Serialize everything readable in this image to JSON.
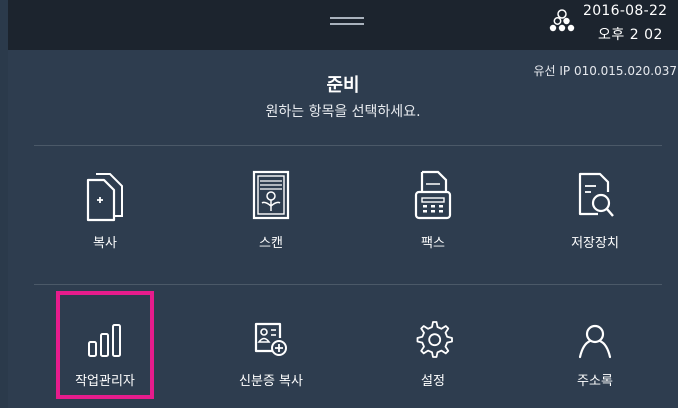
{
  "status": {
    "date": "2016-08-22",
    "time": "오후 2  02",
    "network": "유선 IP 010.015.020.037"
  },
  "header": {
    "title": "준비",
    "subtitle": "원하는 항목을 선택하세요."
  },
  "menu": [
    {
      "label": "복사",
      "icon": "copy-icon"
    },
    {
      "label": "스캔",
      "icon": "scan-icon"
    },
    {
      "label": "팩스",
      "icon": "fax-icon"
    },
    {
      "label": "저장장치",
      "icon": "storage-search-icon"
    },
    {
      "label": "작업관리자",
      "icon": "job-manager-icon",
      "selected": true
    },
    {
      "label": "신분증 복사",
      "icon": "id-card-copy-icon"
    },
    {
      "label": "설정",
      "icon": "settings-gear-icon"
    },
    {
      "label": "주소록",
      "icon": "address-book-person-icon"
    }
  ],
  "colors": {
    "background": "#2e3d4f",
    "topbar": "#1c242e",
    "selection_highlight": "#e61c8c"
  }
}
